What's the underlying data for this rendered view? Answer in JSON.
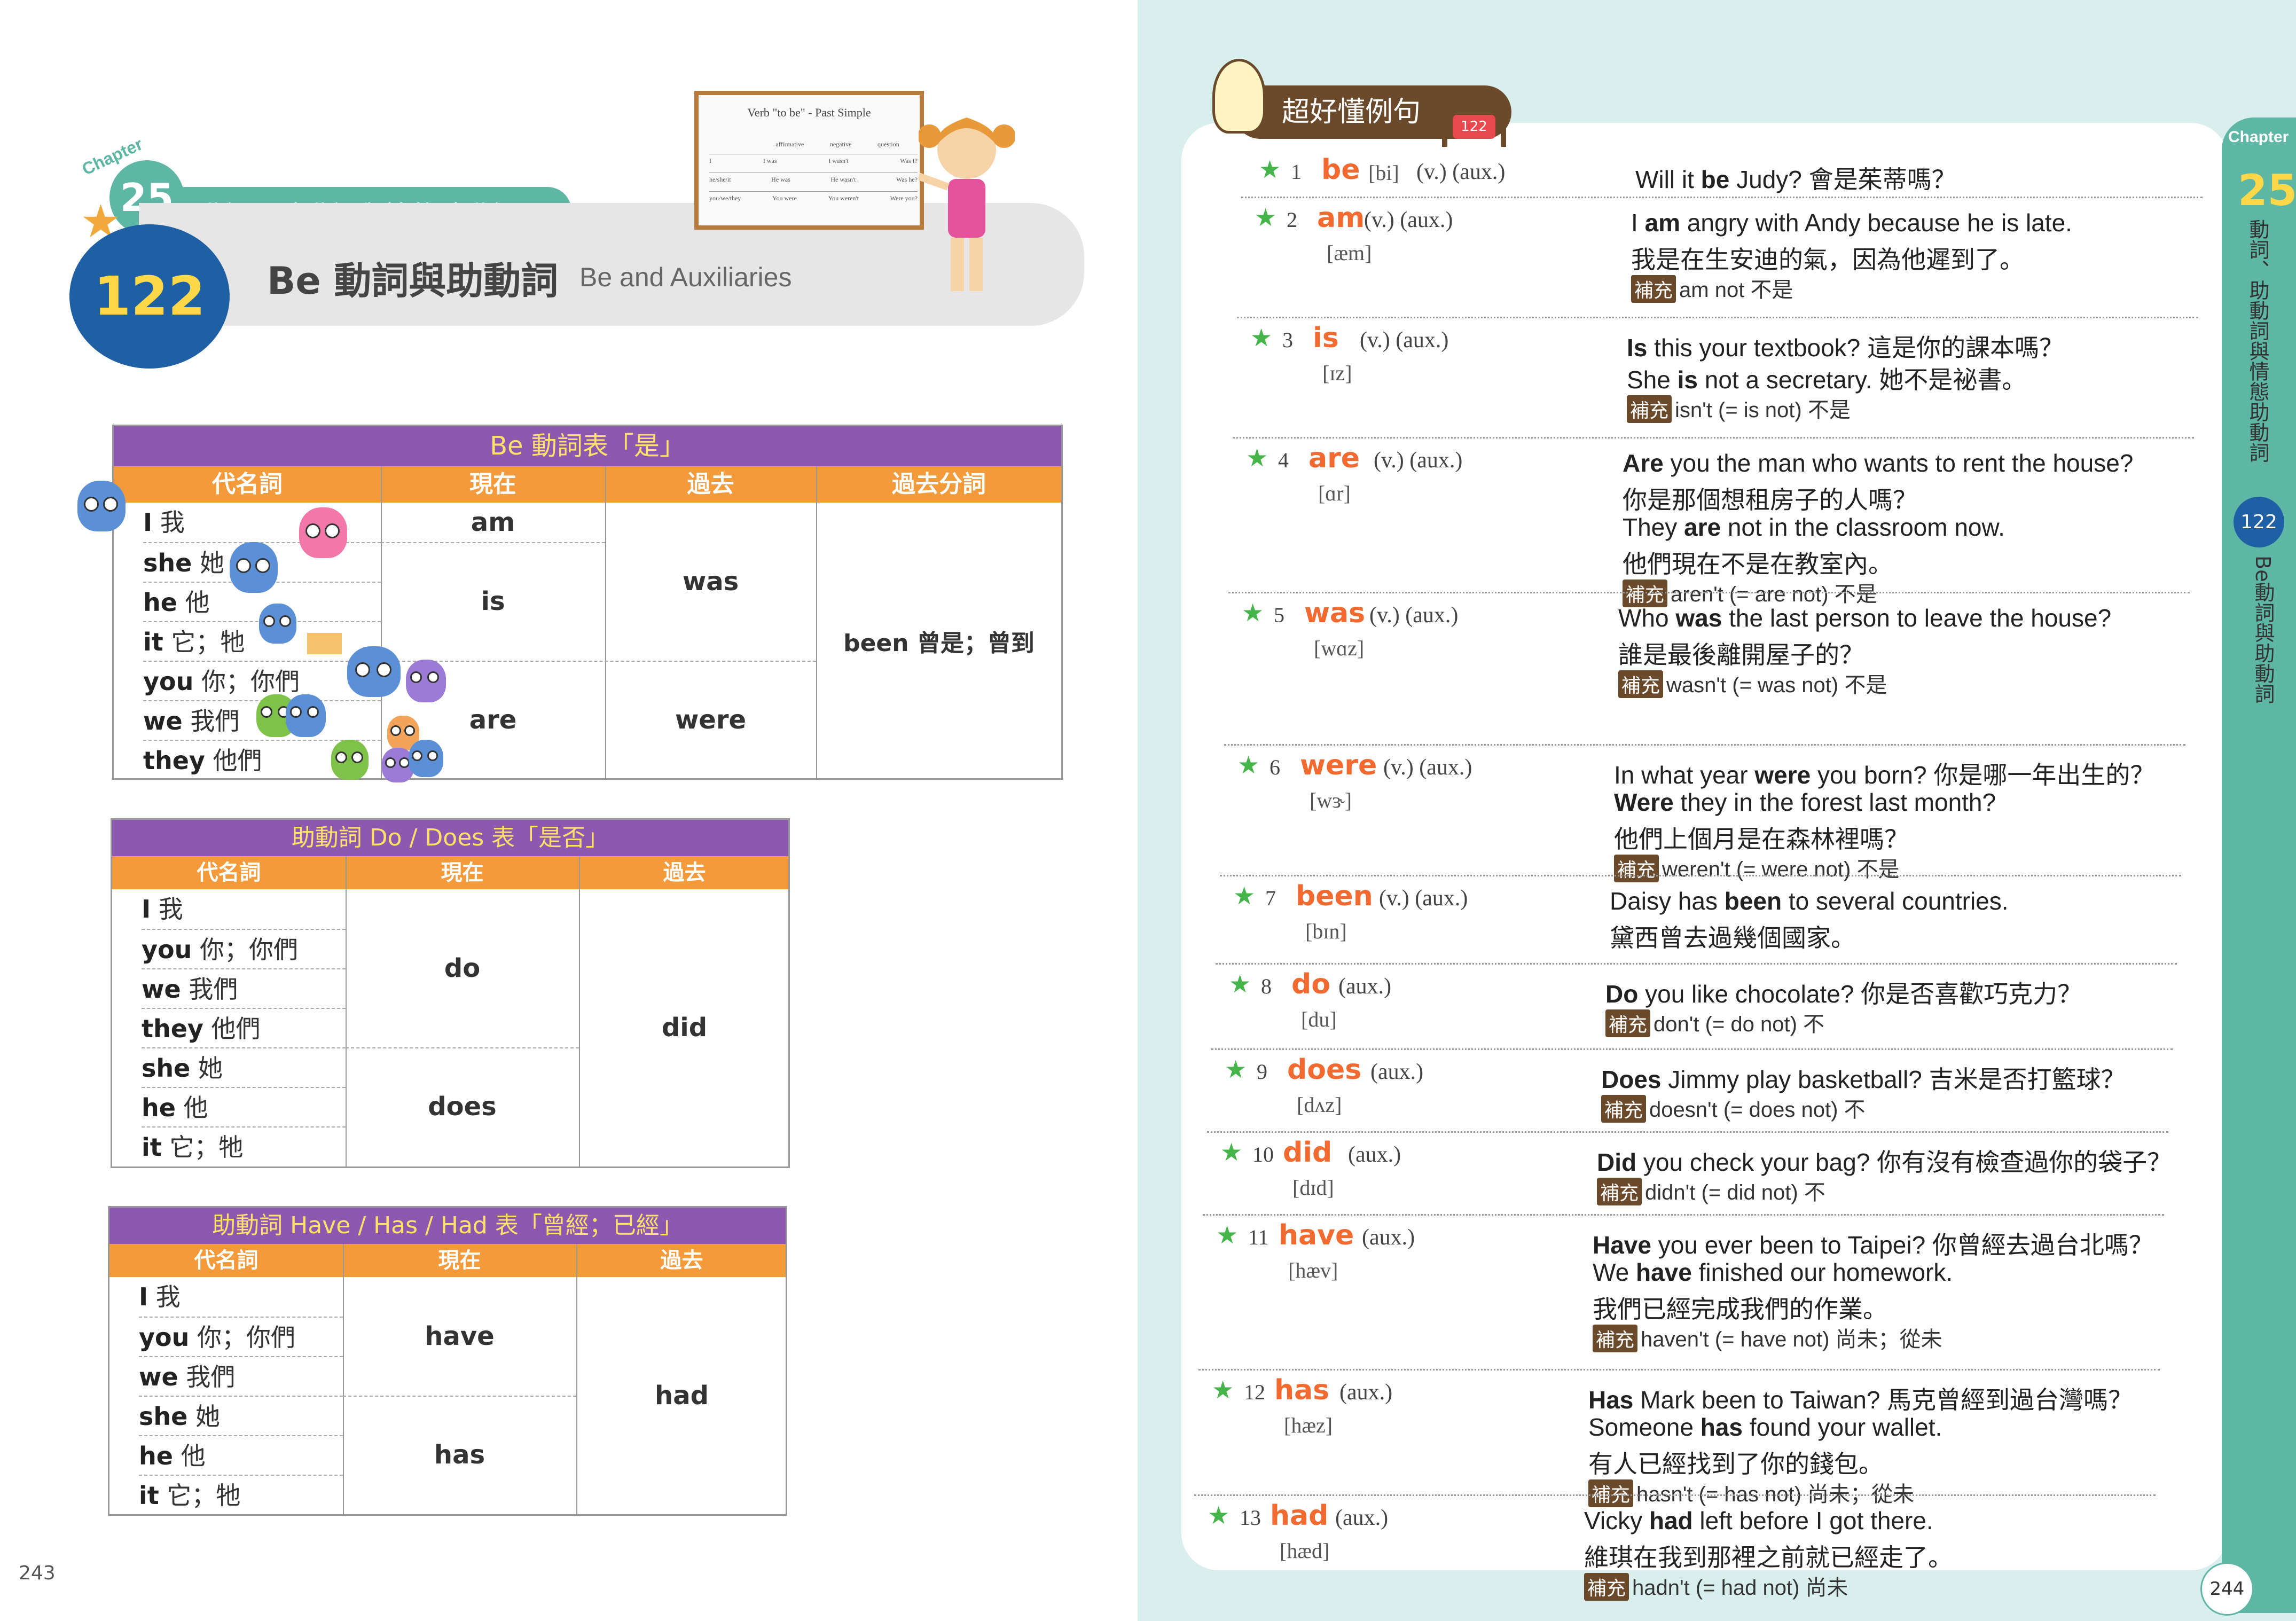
{
  "left": {
    "chapter_word": "Chapter",
    "chapter_num": "25",
    "chapter_title": "動詞、助動詞與情態助動詞",
    "unit_num": "122",
    "unit_title_cn": "Be 動詞與助動詞",
    "unit_title_en": "Be and Auxiliaries",
    "board_title": "Verb \"to be\" - Past Simple",
    "board_headers": [
      "affirmative",
      "negative",
      "question"
    ],
    "board_rows": [
      [
        "I",
        "I was",
        "I wasn't",
        "Was I?"
      ],
      [
        "he/she/it",
        "He was",
        "He wasn't",
        "Was he?"
      ],
      [
        "you/we/they",
        "You were",
        "You weren't",
        "Were you?"
      ]
    ],
    "page_number": "243",
    "table1": {
      "title": "Be 動詞表「是」",
      "headers": [
        "代名詞",
        "現在",
        "過去",
        "過去分詞"
      ],
      "pronouns": [
        {
          "en": "I",
          "cn": "我"
        },
        {
          "en": "she",
          "cn": "她"
        },
        {
          "en": "he",
          "cn": "他"
        },
        {
          "en": "it",
          "cn": "它；牠"
        },
        {
          "en": "you",
          "cn": "你；你們"
        },
        {
          "en": "we",
          "cn": "我們"
        },
        {
          "en": "they",
          "cn": "他們"
        }
      ],
      "present": [
        "am",
        "is",
        "are"
      ],
      "past": [
        "was",
        "were"
      ],
      "participle": "been 曾是；曾到"
    },
    "table2": {
      "title": "助動詞 Do / Does 表「是否」",
      "headers": [
        "代名詞",
        "現在",
        "過去"
      ],
      "pronouns": [
        {
          "en": "I",
          "cn": "我"
        },
        {
          "en": "you",
          "cn": "你；你們"
        },
        {
          "en": "we",
          "cn": "我們"
        },
        {
          "en": "they",
          "cn": "他們"
        },
        {
          "en": "she",
          "cn": "她"
        },
        {
          "en": "he",
          "cn": "他"
        },
        {
          "en": "it",
          "cn": "它；牠"
        }
      ],
      "present": [
        "do",
        "does"
      ],
      "past": "did"
    },
    "table3": {
      "title": "助動詞 Have / Has / Had 表「曾經；已經」",
      "headers": [
        "代名詞",
        "現在",
        "過去"
      ],
      "pronouns": [
        {
          "en": "I",
          "cn": "我"
        },
        {
          "en": "you",
          "cn": "你；你們"
        },
        {
          "en": "we",
          "cn": "我們"
        },
        {
          "en": "she",
          "cn": "她"
        },
        {
          "en": "he",
          "cn": "他"
        },
        {
          "en": "it",
          "cn": "它；牠"
        }
      ],
      "present": [
        "have",
        "has"
      ],
      "past": "had"
    }
  },
  "right": {
    "header": "超好懂例句",
    "audio_track": "122",
    "side_chapter": "Chapter",
    "side_num": "25",
    "side_title": "動詞、助動詞與情態助動詞",
    "side_unit": "122",
    "side_unit_title": "Be動詞與助動詞",
    "page_number": "244",
    "supp_label": "補充",
    "entries": [
      {
        "num": "1",
        "word": "be",
        "ipa": "[bi]",
        "pos": "(v.) (aux.)",
        "lines": [
          "Will it be Judy? 會是茱蒂嗎？"
        ],
        "note": ""
      },
      {
        "num": "2",
        "word": "am",
        "ipa": "[æm]",
        "pos": "(v.) (aux.)",
        "lines": [
          "I am angry with Andy because he is late.",
          "我是在生安迪的氣，因為他遲到了。"
        ],
        "note": "am not 不是"
      },
      {
        "num": "3",
        "word": "is",
        "ipa": "[ɪz]",
        "pos": "(v.) (aux.)",
        "lines": [
          "Is this your textbook? 這是你的課本嗎？",
          "She is not a secretary. 她不是祕書。"
        ],
        "note": "isn't (= is not) 不是"
      },
      {
        "num": "4",
        "word": "are",
        "ipa": "[ɑr]",
        "pos": "(v.) (aux.)",
        "lines": [
          "Are you the man who wants to rent the house?",
          "你是那個想租房子的人嗎？",
          "They are not in the classroom now.",
          "他們現在不是在教室內。"
        ],
        "note": "aren't (= are not) 不是"
      },
      {
        "num": "5",
        "word": "was",
        "ipa": "[wɑz]",
        "pos": "(v.) (aux.)",
        "lines": [
          "Who was the last person to leave the house?",
          "誰是最後離開屋子的？"
        ],
        "note": "wasn't (= was not) 不是"
      },
      {
        "num": "6",
        "word": "were",
        "ipa": "[wɝ]",
        "pos": "(v.) (aux.)",
        "lines": [
          "In what year were you born? 你是哪一年出生的？",
          "Were they in the forest last month?",
          "他們上個月是在森林裡嗎？"
        ],
        "note": "weren't (= were not) 不是"
      },
      {
        "num": "7",
        "word": "been",
        "ipa": "[bɪn]",
        "pos": "(v.) (aux.)",
        "lines": [
          "Daisy has been to several countries.",
          "黛西曾去過幾個國家。"
        ],
        "note": ""
      },
      {
        "num": "8",
        "word": "do",
        "ipa": "[du]",
        "pos": "(aux.)",
        "lines": [
          "Do you like chocolate? 你是否喜歡巧克力？"
        ],
        "note": "don't (= do not) 不"
      },
      {
        "num": "9",
        "word": "does",
        "ipa": "[dʌz]",
        "pos": "(aux.)",
        "lines": [
          "Does Jimmy play basketball? 吉米是否打籃球？"
        ],
        "note": "doesn't (= does not) 不"
      },
      {
        "num": "10",
        "word": "did",
        "ipa": "[dɪd]",
        "pos": "(aux.)",
        "lines": [
          "Did you check your bag? 你有沒有檢查過你的袋子？"
        ],
        "note": "didn't (= did not) 不"
      },
      {
        "num": "11",
        "word": "have",
        "ipa": "[hæv]",
        "pos": "(aux.)",
        "lines": [
          "Have you ever been to Taipei? 你曾經去過台北嗎？",
          "We have finished our homework.",
          "我們已經完成我們的作業。"
        ],
        "note": "haven't (= have not) 尚未；從未"
      },
      {
        "num": "12",
        "word": "has",
        "ipa": "[hæz]",
        "pos": "(aux.)",
        "lines": [
          "Has Mark been to Taiwan? 馬克曾經到過台灣嗎？",
          "Someone has found your wallet.",
          "有人已經找到了你的錢包。"
        ],
        "note": "hasn't (= has not) 尚未；從未"
      },
      {
        "num": "13",
        "word": "had",
        "ipa": "[hæd]",
        "pos": "(aux.)",
        "lines": [
          "Vicky had left before I got there.",
          "維琪在我到那裡之前就已經走了。"
        ],
        "note": "hadn't (= had not) 尚未"
      }
    ]
  },
  "colors": {
    "teal": "#5db7a4",
    "purple": "#8c58b0",
    "orange": "#f39a3a",
    "word_orange": "#f26a30",
    "navy": "#1f5fa3",
    "brown": "#6b4a2b",
    "page_bg_right": "#d9efee"
  }
}
